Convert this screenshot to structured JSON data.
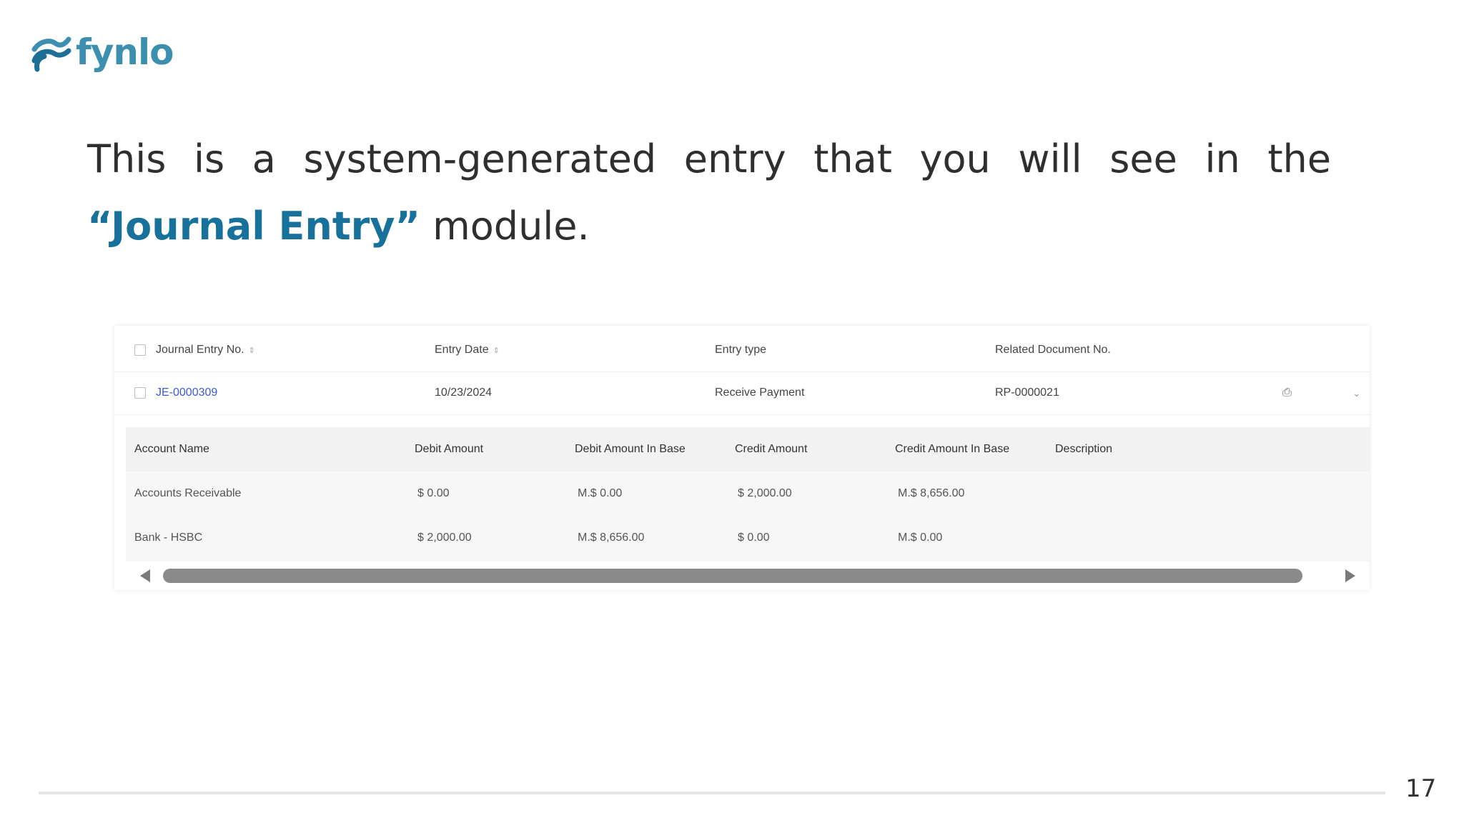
{
  "brand": {
    "name": "fynlo"
  },
  "heading": {
    "part1": "This is a system-generated entry that you will see in the ",
    "highlight": "“Journal Entry”",
    "part2": " module."
  },
  "table": {
    "columns": [
      "Journal Entry No.",
      "Entry Date",
      "Entry type",
      "Related Document No."
    ],
    "row": {
      "entry_no": "JE-0000309",
      "date": "10/23/2024",
      "type": "Receive Payment",
      "doc_no": "RP-0000021"
    }
  },
  "detail": {
    "columns": [
      "Account Name",
      "Debit Amount",
      "Debit Amount In Base",
      "Credit Amount",
      "Credit Amount In Base",
      "Description"
    ],
    "rows": [
      {
        "account": "Accounts Receivable",
        "debit": "$ 0.00",
        "debit_base": "M.$ 0.00",
        "credit": "$ 2,000.00",
        "credit_base": "M.$ 8,656.00",
        "description": ""
      },
      {
        "account": "Bank - HSBC",
        "debit": "$ 2,000.00",
        "debit_base": "M.$ 8,656.00",
        "credit": "$ 0.00",
        "credit_base": "M.$ 0.00",
        "description": ""
      }
    ]
  },
  "page_number": "17",
  "colors": {
    "accent": "#17719b",
    "logo": "#3d8fb0",
    "link": "#3b5bdb"
  }
}
